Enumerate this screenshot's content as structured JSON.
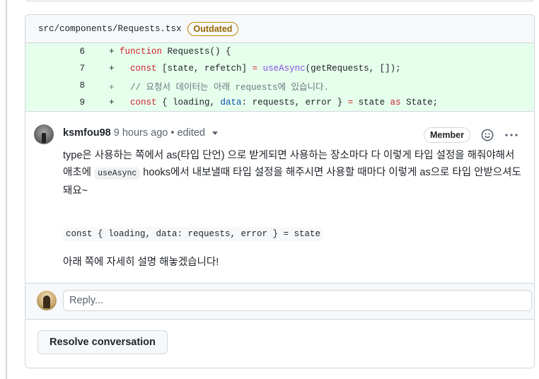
{
  "file": {
    "path": "src/components/Requests.tsx",
    "badge": "Outdated"
  },
  "diff_lines": [
    {
      "number": "6",
      "code": "+ function Requests() {"
    },
    {
      "number": "7",
      "code": "+   const [state, refetch] = useAsync(getRequests, []);"
    },
    {
      "number": "8",
      "code": "+   // 요청서 데이터는 아래 requests에 있습니다."
    },
    {
      "number": "9",
      "code": "+   const { loading, data: requests, error } = state as State;"
    }
  ],
  "comment": {
    "author": "ksmfou98",
    "meta": "9 hours ago • edited",
    "role_badge": "Member",
    "paragraph1": "type은 사용하는 쪽에서 as(타입 단언) 으로 받게되면 사용하는 장소마다 다 이렇게 타입 설정을 해줘야해서",
    "paragraph2_before": "애초에 ",
    "paragraph2_code": "useAsync",
    "paragraph2_after": " hooks에서 내보낼때 타입 설정을 해주시면 사용할 때마다 이렇게 as으로 타입 안받으셔도 돼요~",
    "code_block": "const { loading, data: requests, error } = state",
    "closing": "아래 쪽에 자세히 설명 해놓겠습니다!"
  },
  "reply": {
    "placeholder": "Reply..."
  },
  "resolve_label": "Resolve conversation",
  "icons": {
    "reaction": "smiley-icon",
    "more": "kebab-horizontal-icon",
    "edited_menu": "triangle-down-icon"
  },
  "colors": {
    "diff_add_bg": "#e6ffec",
    "outdated": "#9a6700",
    "border": "#d0d7de"
  }
}
